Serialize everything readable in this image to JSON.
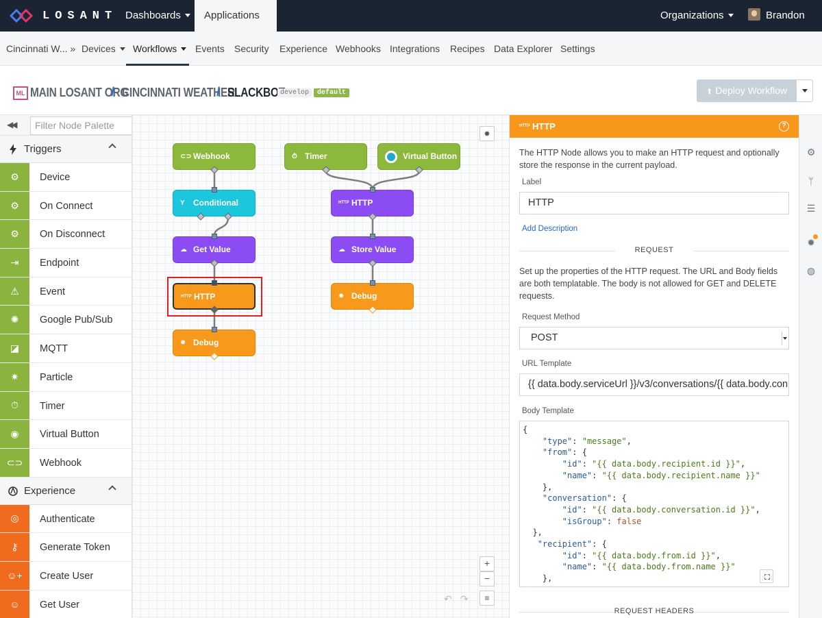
{
  "brand": {
    "name": "LOSANT",
    "accent": "#f7971c"
  },
  "topnav": {
    "dashboards": "Dashboards",
    "applications": "Applications",
    "organizations": "Organizations",
    "user": "Brandon"
  },
  "subnav": {
    "app": "Cincinnati W... »",
    "items": [
      "Devices",
      "Workflows",
      "Events",
      "Security",
      "Experience",
      "Webhooks",
      "Integrations",
      "Recipes",
      "Data Explorer",
      "Settings"
    ],
    "active": "Workflows"
  },
  "breadcrumb": {
    "badge": "ML",
    "org": "MAIN LOSANT ORG",
    "app": "CINCINNATI WEATHER",
    "workflow": "SLACKBOT",
    "version": "develop",
    "tag": "default",
    "sep": "/"
  },
  "deploy": {
    "label": "Deploy Workflow"
  },
  "palette": {
    "filter_placeholder": "Filter Node Palette",
    "triggers": {
      "title": "Triggers",
      "items": [
        "Device",
        "On Connect",
        "On Disconnect",
        "Endpoint",
        "Event",
        "Google Pub/Sub",
        "MQTT",
        "Particle",
        "Timer",
        "Virtual Button",
        "Webhook"
      ]
    },
    "experience": {
      "title": "Experience",
      "items": [
        "Authenticate",
        "Generate Token",
        "Create User",
        "Get User"
      ]
    }
  },
  "canvas": {
    "nodes": {
      "webhook": "Webhook",
      "conditional": "Conditional",
      "get_value": "Get Value",
      "http_left": "HTTP",
      "debug_left": "Debug",
      "timer": "Timer",
      "virtual_button": "Virtual Button",
      "http_right": "HTTP",
      "store_value": "Store Value",
      "debug_right": "Debug"
    },
    "zoom_in": "+",
    "zoom_out": "−"
  },
  "props": {
    "header": "HTTP",
    "header_mini": "HTTP",
    "intro": "The HTTP Node allows you to make an HTTP request and optionally store the response in the current payload.",
    "label_caption": "Label",
    "label_value": "HTTP",
    "add_description": "Add Description",
    "request_heading": "REQUEST",
    "request_text": "Set up the properties of the HTTP request. The URL and Body fields are both templatable. The body is not allowed for GET and DELETE requests.",
    "method_caption": "Request Method",
    "method_value": "POST",
    "url_caption": "URL Template",
    "url_value": "{{ data.body.serviceUrl }}/v3/conversations/{{ data.body.con",
    "body_caption": "Body Template",
    "body_lines": [
      "{",
      "    \"type\": \"message\",",
      "    \"from\": {",
      "        \"id\": \"{{ data.body.recipient.id }}\",",
      "        \"name\": \"{{ data.body.recipient.name }}\"",
      "    },",
      "    \"conversation\": {",
      "        \"id\": \"{{ data.body.conversation.id }}\",",
      "        \"isGroup\": false",
      "  },",
      "   \"recipient\": {",
      "        \"id\": \"{{ data.body.from.id }}\",",
      "        \"name\": \"{{ data.body.from.name }}\"",
      "    },"
    ],
    "headers_heading": "REQUEST HEADERS"
  }
}
